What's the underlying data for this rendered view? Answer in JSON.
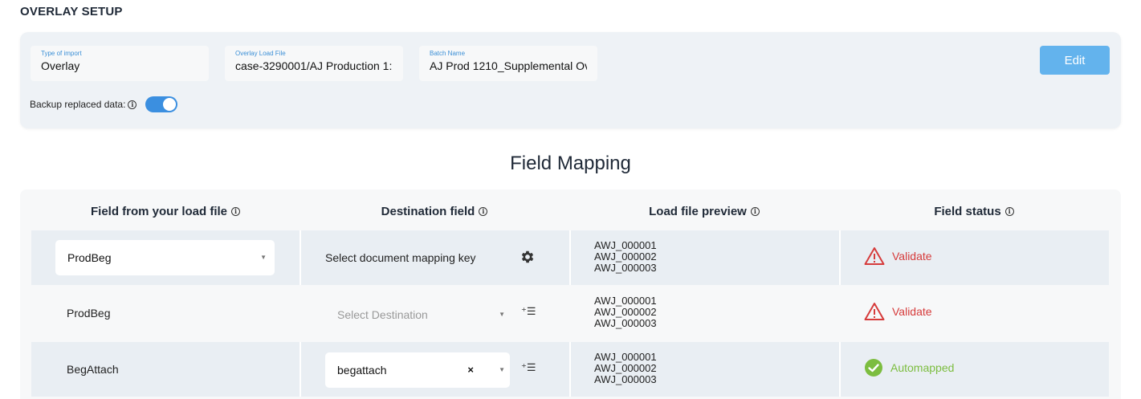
{
  "page_title": "OVERLAY SETUP",
  "setup": {
    "type_label": "Type of import",
    "type_value": "Overlay",
    "load_file_label": "Overlay Load File",
    "load_file_value": "case-3290001/AJ Production 1:",
    "batch_label": "Batch Name",
    "batch_value": "AJ Prod 1210_Supplemental Ov",
    "edit_label": "Edit",
    "backup_label": "Backup replaced data:",
    "backup_enabled": true
  },
  "section_title": "Field Mapping",
  "table": {
    "headers": [
      "Field from your load file",
      "Destination field",
      "Load file preview",
      "Field status"
    ],
    "rows": [
      {
        "source": "ProdBeg",
        "destination": "Select document mapping key",
        "preview": [
          "AWJ_000001",
          "AWJ_000002",
          "AWJ_000003"
        ],
        "status": "Validate"
      },
      {
        "source": "ProdBeg",
        "destination_placeholder": "Select Destination",
        "preview": [
          "AWJ_000001",
          "AWJ_000002",
          "AWJ_000003"
        ],
        "status": "Validate"
      },
      {
        "source": "BegAttach",
        "destination": "begattach",
        "clear_symbol": "×",
        "preview": [
          "AWJ_000001",
          "AWJ_000002",
          "AWJ_000003"
        ],
        "status": "Automapped"
      }
    ]
  },
  "colors": {
    "accent": "#3b8fe0",
    "edit_button": "#63b3ed",
    "warning": "#d63b3b",
    "success": "#7cbd3f"
  }
}
